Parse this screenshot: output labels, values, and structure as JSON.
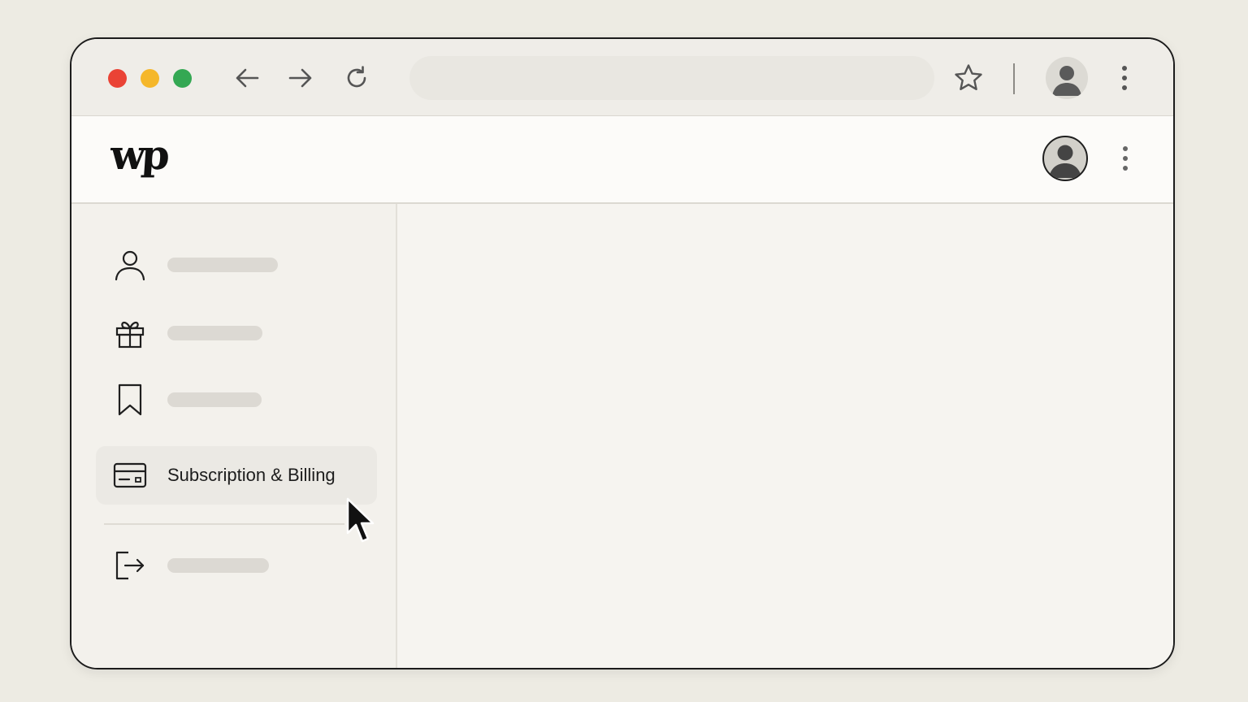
{
  "browser": {
    "traffic_lights": {
      "close": "#ea4335",
      "minimize": "#f5b72a",
      "maximize": "#34a853"
    },
    "back_icon": "arrow-left-icon",
    "forward_icon": "arrow-right-icon",
    "reload_icon": "reload-icon",
    "address_value": "",
    "bookmark_icon": "star-icon",
    "profile_icon": "avatar-icon",
    "menu_icon": "kebab-menu-icon"
  },
  "site": {
    "logo_text": "wp",
    "profile_icon": "avatar-icon",
    "menu_icon": "kebab-menu-icon"
  },
  "sidebar": {
    "items": [
      {
        "icon": "person-icon",
        "label": ""
      },
      {
        "icon": "gift-icon",
        "label": ""
      },
      {
        "icon": "bookmark-icon",
        "label": ""
      },
      {
        "icon": "credit-card-icon",
        "label": "Subscription & Billing",
        "active": true
      },
      {
        "icon": "sign-out-icon",
        "label": ""
      }
    ]
  },
  "colors": {
    "page_bg": "#edebe3",
    "sidebar_bg": "#f3f1ec",
    "active_item_bg": "#ebe9e4",
    "skeleton": "#dcd9d3"
  }
}
